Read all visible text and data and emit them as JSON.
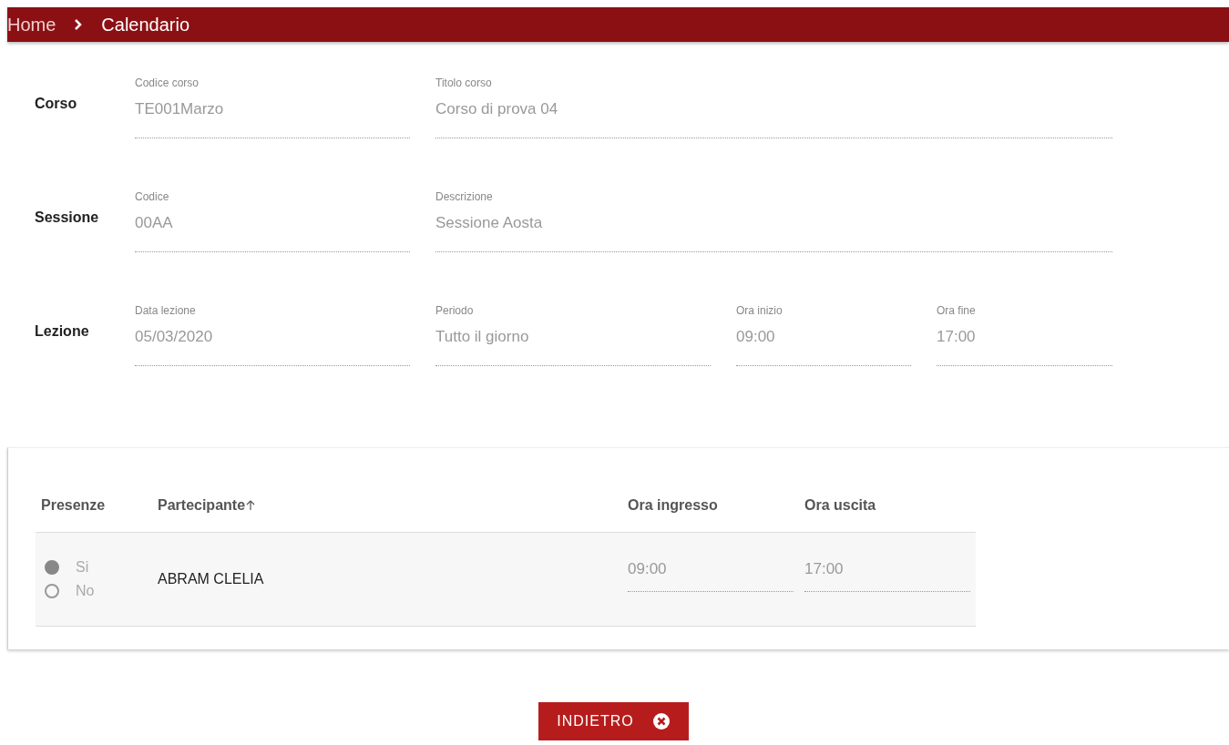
{
  "breadcrumb": [
    "Home",
    "Calendario"
  ],
  "sections": [
    {
      "label": "Corso",
      "fields": [
        {
          "label": "Codice corso",
          "value": "TE001Marzo"
        },
        {
          "label": "Titolo corso",
          "value": "Corso di prova 04"
        }
      ]
    },
    {
      "label": "Sessione",
      "fields": [
        {
          "label": "Codice",
          "value": "00AA"
        },
        {
          "label": "Descrizione",
          "value": "Sessione Aosta"
        }
      ]
    },
    {
      "label": "Lezione",
      "fields": [
        {
          "label": "Data lezione",
          "value": "05/03/2020"
        },
        {
          "label": "Periodo",
          "value": "Tutto il giorno"
        },
        {
          "label": "Ora inizio",
          "value": "09:00"
        },
        {
          "label": "Ora fine",
          "value": "17:00"
        }
      ]
    }
  ],
  "table": {
    "columns": [
      {
        "label": "Presenze",
        "sorted": false
      },
      {
        "label": "Partecipante",
        "sorted": true
      },
      {
        "label": "Ora ingresso",
        "sorted": false
      },
      {
        "label": "Ora uscita",
        "sorted": false
      }
    ],
    "rows": [
      {
        "presence": [
          {
            "label": "Si",
            "selected": true
          },
          {
            "label": "No",
            "selected": false
          }
        ],
        "name": "ABRAM CLELIA",
        "entry": "09:00",
        "exit": "17:00"
      }
    ]
  },
  "back_button": "INDIETRO"
}
